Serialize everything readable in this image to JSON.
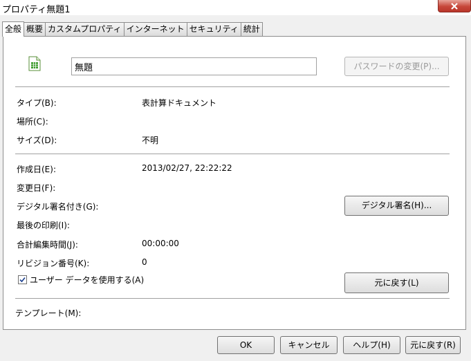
{
  "window": {
    "title": "プロパティ無題1"
  },
  "tabs": [
    {
      "label": "全般"
    },
    {
      "label": "概要"
    },
    {
      "label": "カスタムプロパティ"
    },
    {
      "label": "インターネット"
    },
    {
      "label": "セキュリティ"
    },
    {
      "label": "統計"
    }
  ],
  "general": {
    "doc_name": "無題",
    "password_button": "パスワードの変更(P)...",
    "type_label": "タイプ(B):",
    "type_value": "表計算ドキュメント",
    "location_label": "場所(C):",
    "size_label": "サイズ(D):",
    "size_value": "不明",
    "created_label": "作成日(E):",
    "created_value": "2013/02/27, 22:22:22",
    "modified_label": "変更日(F):",
    "signed_label": "デジタル署名付き(G):",
    "signature_button": "デジタル署名(H)...",
    "printed_label": "最後の印刷(I):",
    "edit_time_label": "合計編集時間(J):",
    "edit_time_value": "00:00:00",
    "revision_label": "リビジョン番号(K):",
    "revision_value": "0",
    "userdata_label": "ユーザー データを使用する(A)",
    "reset_button": "元に戻す(L)",
    "template_label": "テンプレート(M):"
  },
  "footer": {
    "ok": "OK",
    "cancel": "キャンセル",
    "help": "ヘルプ(H)",
    "reset": "元に戻す(R)"
  },
  "colors": {
    "close_red": "#c7473a",
    "spreadsheet_icon": "#3a9a2a"
  },
  "icons": {
    "close": "close-icon",
    "document": "spreadsheet-icon",
    "check": "checkmark-icon"
  }
}
